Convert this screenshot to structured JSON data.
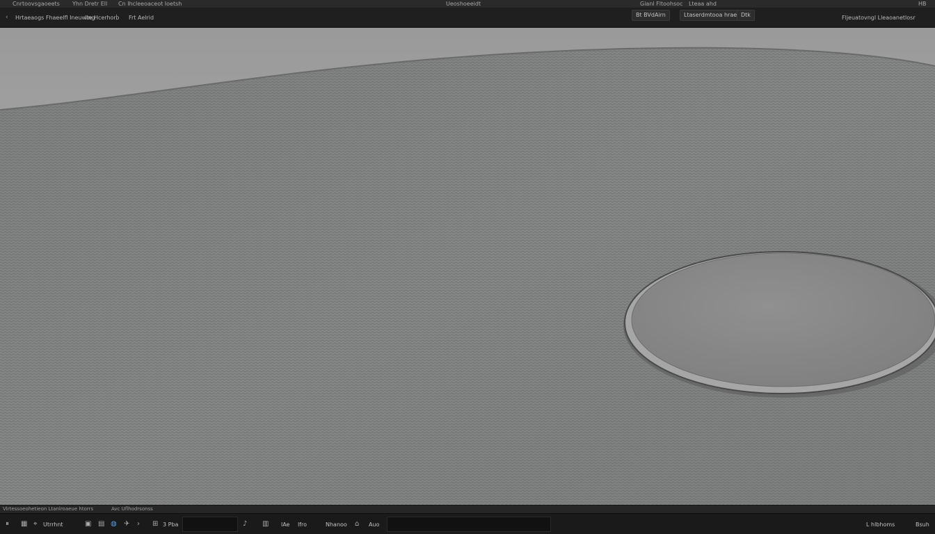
{
  "title_bar": {
    "menu_left": "Cnrtoovsgaoeets",
    "menu_mid": "Yhn Dretr Ell",
    "menu_file": "Cn Ihcleeoaceot Ioetsh",
    "window_title": "Ueoshoeeidt",
    "right_label": "HB"
  },
  "toolbar": {
    "tab_main": "Hrtaeaogs Fhaeelfl Ineuwing",
    "tab_filter": "Ite Hcerhoro",
    "tab_extra": "Frt Aelrid",
    "sel_left": "Gianl Fltoohsoc",
    "sel_right": "Lteaa ahd",
    "btn_render": "Bt BVdAirn",
    "btn_options": "Ltaserdmtooa hrae",
    "btn_view": "Dtk",
    "far_right": "Fljeuatovngl   Lleaoanetlosr"
  },
  "timeline": {
    "left": "Vlrtessoeohetieon   Ltanlroaeue   htorrs",
    "mid": "Avc Uflhodrsonss"
  },
  "statusbar": {
    "camera": "Utrrhnt",
    "layer": "3 Pba",
    "tool": "lAe",
    "frame": "lfro",
    "scale": "Nhanoo",
    "mode": "Auo",
    "coords": "L hlbhoms",
    "right": "Bsuh"
  },
  "colors": {
    "ui_dark": "#1a1a1a",
    "viewport_surface": "#8e8e8e",
    "disc": "#8a8a8a"
  }
}
